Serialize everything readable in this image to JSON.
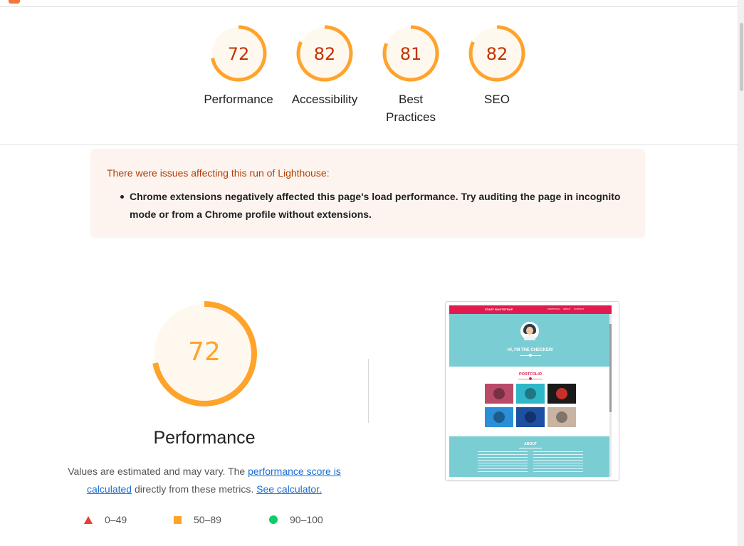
{
  "colors": {
    "average": "#ffa32b",
    "average_text": "#c33300",
    "average_fill": "#fff8ee",
    "fail": "#eb3c30",
    "pass": "#0cce6b",
    "link": "#1a6ed3",
    "warning_bg": "#fdf4ef",
    "warning_text": "#b03f06"
  },
  "gauges": [
    {
      "score": "72",
      "value": 72,
      "label": "Performance"
    },
    {
      "score": "82",
      "value": 82,
      "label": "Accessibility"
    },
    {
      "score": "81",
      "value": 81,
      "label": "Best Practices"
    },
    {
      "score": "82",
      "value": 82,
      "label": "SEO"
    }
  ],
  "warning": {
    "title": "There were issues affecting this run of Lighthouse:",
    "items": [
      "Chrome extensions negatively affected this page's load performance. Try auditing the page in incognito mode or from a Chrome profile without extensions."
    ]
  },
  "performance": {
    "score": "72",
    "value": 72,
    "title": "Performance",
    "desc_prefix": "Values are estimated and may vary. The ",
    "link_score": "performance score is calculated",
    "desc_middle": " directly from these metrics. ",
    "link_calc": "See calculator."
  },
  "legend": [
    {
      "icon": "triangle-icon",
      "range": "0–49"
    },
    {
      "icon": "square-icon",
      "range": "50–89"
    },
    {
      "icon": "circle-icon",
      "range": "90–100"
    }
  ],
  "screenshot": {
    "brand": "START BOOTSTRAP",
    "nav_links": "PORTFOLIO ABOUT CONTACT",
    "hero_title": "HI, I'M THE CHECKER!",
    "portfolio_title": "PORTFOLIO",
    "about_title": "ABOUT",
    "tile_colors": [
      "#b94a68",
      "#2fb7c7",
      "#1a1a1a",
      "#2a8fd6",
      "#1d4fa3",
      "#c9b3a3"
    ]
  }
}
